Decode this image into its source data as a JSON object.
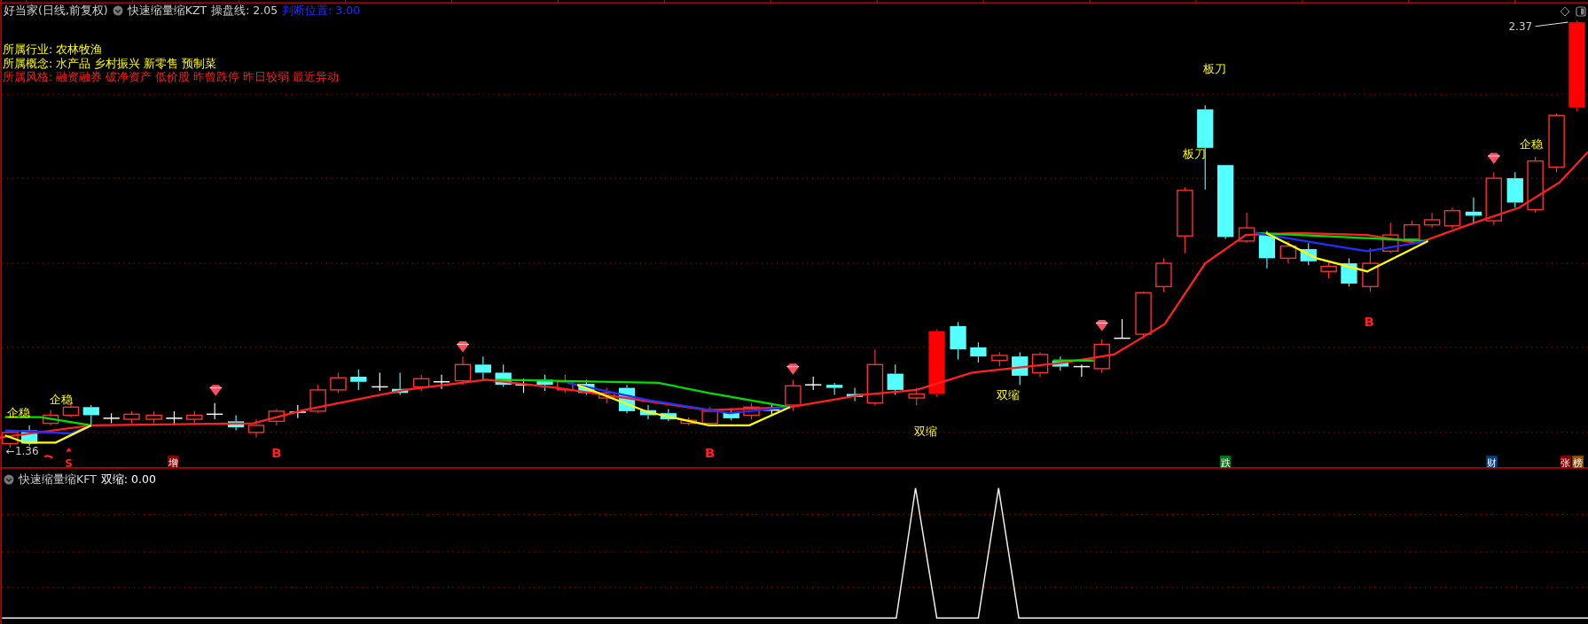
{
  "window": {
    "stock": "好当家(日线,前复权)",
    "indicator": "快速缩量缩KZT",
    "readings": [
      {
        "label": "操盘线: 2.05",
        "kind": "normal"
      },
      {
        "label": "判断位置: 3.00",
        "kind": "highlight"
      }
    ]
  },
  "info": [
    {
      "text": "所属行业: 农林牧渔",
      "kind": "normal"
    },
    {
      "text": "所属概念: 水产品 乡村振兴 新零售 预制菜",
      "kind": "normal"
    },
    {
      "text": "所属风格: 融资融券 破净资产 低价股 昨曾跌停 昨日较弱 最近异动",
      "kind": "warning"
    }
  ],
  "price_labels": {
    "high": "2.37",
    "low": "←1.36"
  },
  "signals": [
    {
      "text": "企稳",
      "kind": "stable"
    },
    {
      "text": "企稳",
      "kind": "stable"
    },
    {
      "text": "S",
      "kind": "sell"
    },
    {
      "text": "B",
      "kind": "buy"
    },
    {
      "text": "B",
      "kind": "buy"
    },
    {
      "text": "双缩",
      "kind": "stable"
    },
    {
      "text": "双缩",
      "kind": "stable"
    },
    {
      "text": "板刀",
      "kind": "stable"
    },
    {
      "text": "板刀",
      "kind": "stable"
    },
    {
      "text": "B",
      "kind": "buy"
    },
    {
      "text": "企稳",
      "kind": "stable"
    }
  ],
  "badges": [
    {
      "text": "增",
      "color": "#8b0000"
    },
    {
      "text": "跌",
      "color": "#007a1a"
    },
    {
      "text": "财",
      "color": "#0a3f7a"
    },
    {
      "text": "张",
      "color": "#8b0000"
    },
    {
      "text": "榜",
      "color": "#9a5200"
    }
  ],
  "lower_panel": {
    "indicator": "快速缩量缩KFT",
    "reading": "双缩: 0.00"
  }
}
